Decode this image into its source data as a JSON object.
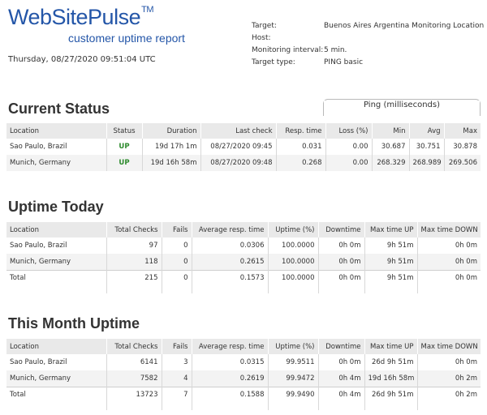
{
  "header": {
    "logo_text": "WebSitePulse",
    "logo_tm": "TM",
    "subtitle": "customer uptime report",
    "timestamp": "Thursday, 08/27/2020 09:51:04 UTC"
  },
  "meta": {
    "target_label": "Target:",
    "target_value": "Buenos Aires Argentina Monitoring Location",
    "host_label": "Host:",
    "host_value": "",
    "interval_label": "Monitoring interval:",
    "interval_value": "5 min.",
    "type_label": "Target type:",
    "type_value": "PING basic"
  },
  "current_status": {
    "title": "Current Status",
    "ping_group_label": "Ping (milliseconds)",
    "columns": [
      "Location",
      "Status",
      "Duration",
      "Last check",
      "Resp. time",
      "Loss (%)",
      "Min",
      "Avg",
      "Max"
    ],
    "rows": [
      [
        "Sao Paulo, Brazil",
        "UP",
        "19d 17h 1m",
        "08/27/2020 09:45",
        "0.031",
        "0.00",
        "30.687",
        "30.751",
        "30.878"
      ],
      [
        "Munich, Germany",
        "UP",
        "19d 16h 58m",
        "08/27/2020 09:48",
        "0.268",
        "0.00",
        "268.329",
        "268.989",
        "269.506"
      ]
    ]
  },
  "uptime_today": {
    "title": "Uptime Today",
    "columns": [
      "Location",
      "Total Checks",
      "Fails",
      "Average resp. time",
      "Uptime (%)",
      "Downtime",
      "Max time UP",
      "Max time DOWN"
    ],
    "rows": [
      [
        "Sao Paulo, Brazil",
        "97",
        "0",
        "0.0306",
        "100.0000",
        "0h 0m",
        "9h 51m",
        "0h 0m"
      ],
      [
        "Munich, Germany",
        "118",
        "0",
        "0.2615",
        "100.0000",
        "0h 0m",
        "9h 51m",
        "0h 0m"
      ],
      [
        "Total",
        "215",
        "0",
        "0.1573",
        "100.0000",
        "0h 0m",
        "9h 51m",
        "0h 0m"
      ]
    ]
  },
  "month_uptime": {
    "title": "This Month Uptime",
    "columns": [
      "Location",
      "Total Checks",
      "Fails",
      "Average resp. time",
      "Uptime (%)",
      "Downtime",
      "Max time UP",
      "Max time DOWN"
    ],
    "rows": [
      [
        "Sao Paulo, Brazil",
        "6141",
        "3",
        "0.0315",
        "99.9511",
        "0h 0m",
        "26d 9h 51m",
        "0h 0m"
      ],
      [
        "Munich, Germany",
        "7582",
        "4",
        "0.2619",
        "99.9472",
        "0h 4m",
        "19d 16h 58m",
        "0h 2m"
      ],
      [
        "Total",
        "13723",
        "7",
        "0.1588",
        "99.9490",
        "0h 4m",
        "26d 9h 51m",
        "0h 2m"
      ]
    ]
  },
  "colors": {
    "brand": "#2456a8",
    "status_up": "#2e8b2e",
    "header_bg": "#e9e9e9",
    "row_alt_bg": "#f3f3f3"
  }
}
